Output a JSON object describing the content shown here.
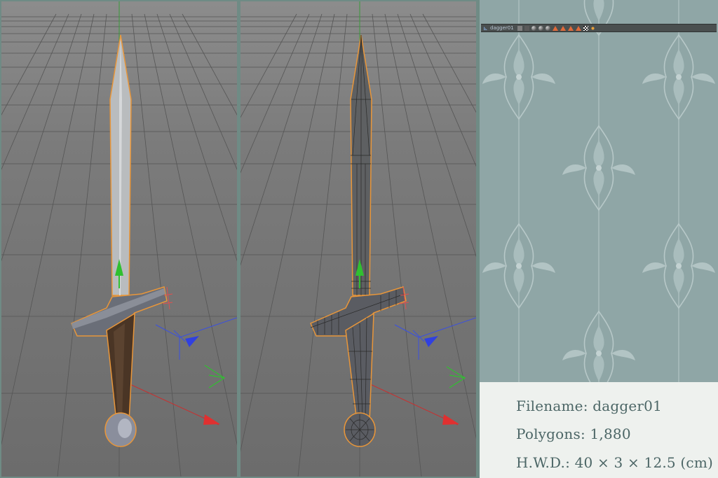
{
  "object_manager": {
    "object_name": "dagger01"
  },
  "info": {
    "filename_label": "Filename:",
    "filename_value": "dagger01",
    "polygons_label": "Polygons:",
    "polygons_value": "1,880",
    "hwd_label": "H.W.D.:",
    "hwd_value": "40 × 3 × 12.5 (cm)"
  },
  "viewports": [
    {
      "name": "shaded",
      "display": "Gouraud Shading"
    },
    {
      "name": "wireframe",
      "display": "Gouraud Shading (Lines)"
    }
  ],
  "colors": {
    "axis_x": "#e03030",
    "axis_y": "#30c030",
    "axis_z": "#3040e0",
    "selection_outline": "#e8963a",
    "panel_bg": "#8fa6a6",
    "info_text": "#4c6666"
  },
  "icons": [
    "null-object-icon",
    "material-ball-icon",
    "tag-icon",
    "checker-icon"
  ]
}
